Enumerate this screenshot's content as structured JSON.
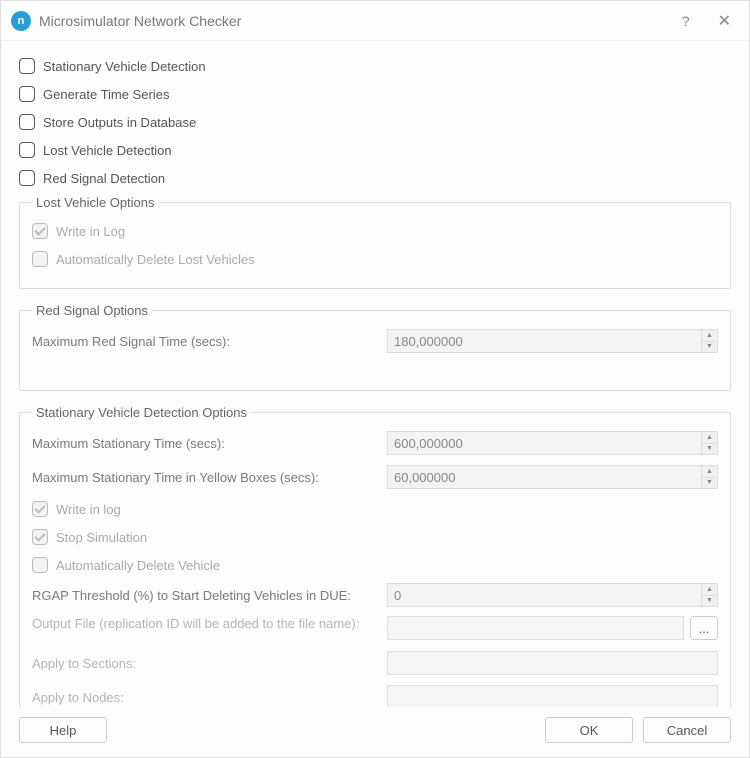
{
  "window": {
    "title": "Microsimulator Network Checker",
    "app_icon_letter": "n",
    "help_glyph": "?",
    "close_glyph": "✕"
  },
  "top_checks": [
    {
      "label": "Stationary Vehicle Detection",
      "checked": false,
      "enabled": true
    },
    {
      "label": "Generate Time Series",
      "checked": false,
      "enabled": true
    },
    {
      "label": "Store Outputs in Database",
      "checked": false,
      "enabled": true
    },
    {
      "label": "Lost Vehicle Detection",
      "checked": false,
      "enabled": true
    },
    {
      "label": "Red Signal Detection",
      "checked": false,
      "enabled": true
    }
  ],
  "lost_vehicle": {
    "legend": "Lost Vehicle Options",
    "write_log": {
      "label": "Write in Log",
      "checked": true,
      "enabled": false
    },
    "auto_delete": {
      "label": "Automatically Delete Lost Vehicles",
      "checked": false,
      "enabled": false
    }
  },
  "red_signal": {
    "legend": "Red Signal Options",
    "max_time_label": "Maximum Red Signal Time (secs):",
    "max_time_value": "180,000000"
  },
  "stationary": {
    "legend": "Stationary Vehicle Detection Options",
    "max_time_label": "Maximum Stationary Time (secs):",
    "max_time_value": "600,000000",
    "max_yellow_label": "Maximum Stationary Time in Yellow Boxes (secs):",
    "max_yellow_value": "60,000000",
    "write_log": {
      "label": "Write in log",
      "checked": true,
      "enabled": false
    },
    "stop_sim": {
      "label": "Stop Simulation",
      "checked": true,
      "enabled": false
    },
    "auto_delete": {
      "label": "Automatically Delete Vehicle",
      "checked": false,
      "enabled": false
    },
    "rgap_label": "RGAP Threshold (%) to Start Deleting Vehicles in DUE:",
    "rgap_value": "0",
    "output_label": "Output File (replication ID will be added to the file name):",
    "output_value": "",
    "browse_glyph": "...",
    "sections_label": "Apply to Sections:",
    "sections_value": "",
    "nodes_label": "Apply to Nodes:",
    "nodes_value": ""
  },
  "footer": {
    "help": "Help",
    "ok": "OK",
    "cancel": "Cancel"
  }
}
